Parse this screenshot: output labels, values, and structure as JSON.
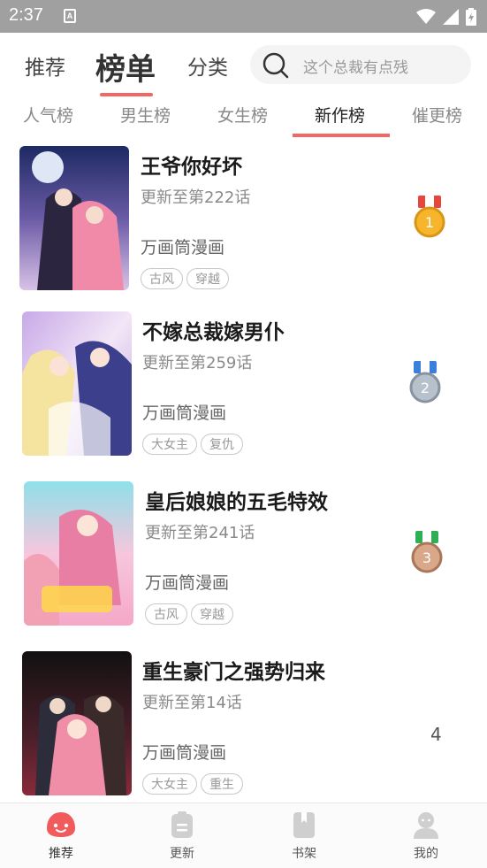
{
  "status_bar": {
    "time": "2:37",
    "notification_letter": "A"
  },
  "top_nav": {
    "tabs": [
      "推荐",
      "榜单",
      "分类"
    ],
    "active_tab": "榜单",
    "search_placeholder": "这个总裁有点残"
  },
  "sub_tabs": {
    "items": [
      "人气榜",
      "男生榜",
      "女生榜",
      "新作榜",
      "催更榜"
    ],
    "active": "新作榜"
  },
  "comics": [
    {
      "title": "王爷你好坏",
      "update": "更新至第222话",
      "author": "万画筒漫画",
      "tags": [
        "古风",
        "穿越"
      ],
      "rank": "1",
      "medal": "gold",
      "ribbon": "#e8453c"
    },
    {
      "title": "不嫁总裁嫁男仆",
      "update": "更新至第259话",
      "author": "万画筒漫画",
      "tags": [
        "大女主",
        "复仇"
      ],
      "rank": "2",
      "medal": "silver",
      "ribbon": "#3a7fd9"
    },
    {
      "title": "皇后娘娘的五毛特效",
      "update": "更新至第241话",
      "author": "万画筒漫画",
      "tags": [
        "古风",
        "穿越"
      ],
      "rank": "3",
      "medal": "bronze",
      "ribbon": "#2fae55"
    },
    {
      "title": "重生豪门之强势归来",
      "update": "更新至第14话",
      "author": "万画筒漫画",
      "tags": [
        "大女主",
        "重生"
      ],
      "rank": "4",
      "medal": "none"
    }
  ],
  "bottom_nav": {
    "items": [
      "推荐",
      "更新",
      "书架",
      "我的"
    ],
    "active": "推荐"
  },
  "colors": {
    "accent": "#f26763",
    "status_bar": "#a0a0a0"
  }
}
